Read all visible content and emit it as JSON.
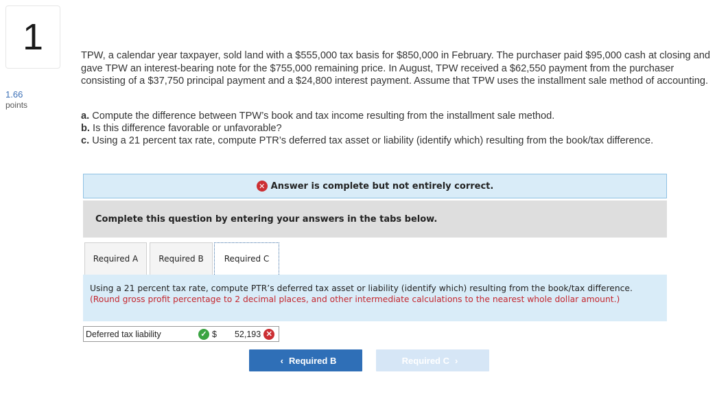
{
  "question": {
    "number": "1",
    "points_value": "1.66",
    "points_label": "points",
    "prompt": "TPW, a calendar year taxpayer, sold land with a $555,000 tax basis for $850,000 in February. The purchaser paid $95,000 cash at closing and gave TPW an interest-bearing note for the $755,000 remaining price. In August, TPW received a $62,550 payment from the purchaser consisting of a $37,750 principal payment and a $24,800 interest payment. Assume that TPW uses the installment sale method of accounting.",
    "parts": [
      {
        "letter": "a.",
        "text": " Compute the difference between TPW’s book and tax income resulting from the installment sale method."
      },
      {
        "letter": "b.",
        "text": " Is this difference favorable or unfavorable?"
      },
      {
        "letter": "c.",
        "text": " Using a 21 percent tax rate, compute PTR’s deferred tax asset or liability (identify which) resulting from the book/tax difference."
      }
    ]
  },
  "banner": {
    "icon": "x-circle-icon",
    "text": "Answer is complete but not entirely correct."
  },
  "instruction": "Complete this question by entering your answers in the tabs below.",
  "tabs": [
    {
      "label": "Required A"
    },
    {
      "label": "Required B"
    },
    {
      "label": "Required C"
    }
  ],
  "active_tab": "Required C",
  "tab_content": {
    "text": "Using a 21 percent tax rate, compute PTR’s deferred tax asset or liability (identify which) resulting from the book/tax difference.",
    "note": "(Round gross profit percentage to 2 decimal places, and other intermediate calculations to the nearest whole dollar amount.)"
  },
  "answer": {
    "label": "Deferred tax liability",
    "label_status": "correct",
    "currency": "$",
    "value": "52,193",
    "value_status": "incorrect"
  },
  "nav": {
    "prev_label": "Required B",
    "next_label": "Required C"
  },
  "colors": {
    "banner_bg": "#d9ecf8",
    "error_red": "#cc2f33",
    "correct_green": "#3aa442",
    "primary_button": "#2f6fb7",
    "disabled_button": "#d6e6f6"
  }
}
